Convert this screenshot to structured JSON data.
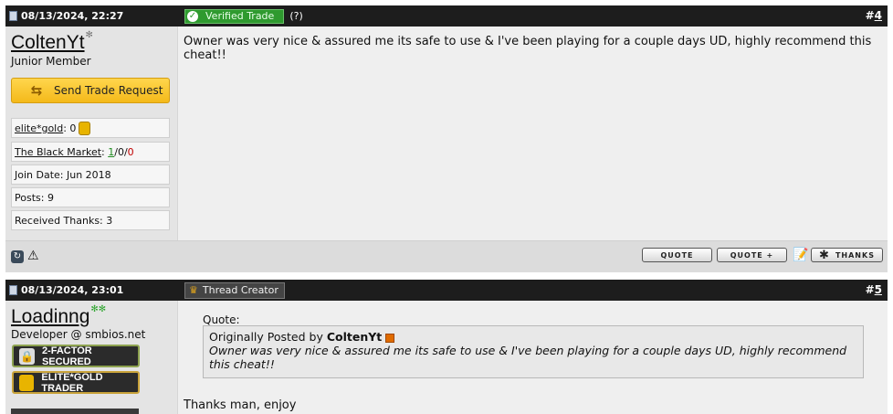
{
  "posts": [
    {
      "date": "08/13/2024, 22:27",
      "badge": "Verified Trade",
      "help": "(?)",
      "number_prefix": "#",
      "number": "4",
      "username": "ColtenYt",
      "role": "Junior Member",
      "trade_button": "Send Trade Request",
      "stats": {
        "elite_gold_label": "elite*gold",
        "elite_gold_value": ": 0",
        "black_market_label": "The Black Market",
        "bm_sep1": ": ",
        "bm_pos": "1",
        "bm_sep2": "/0/",
        "bm_neg": "0",
        "join_date": "Join Date: Jun 2018",
        "posts": "Posts: 9",
        "thanks": "Received Thanks: 3"
      },
      "message": "Owner was very nice & assured me its safe to use & I've been playing for a couple days UD, highly recommend this cheat!!",
      "footer": {
        "quote": "QUOTE",
        "multiquote": "QUOTE +",
        "thanks": "THANKS"
      }
    },
    {
      "date": "08/13/2024, 23:01",
      "badge": "Thread Creator",
      "number_prefix": "#",
      "number": "5",
      "username": "Loadinng",
      "role": "Developer @ smbios.net",
      "badges": [
        "2-FACTOR SECURED",
        "ELITE*GOLD TRADER"
      ],
      "quote_label": "Quote:",
      "quote_prefix": "Originally Posted by",
      "quote_author": "ColtenYt",
      "quote_text": "Owner was very nice & assured me its safe to use & I've been playing for a couple days UD, highly recommend this cheat!!",
      "message": "Thanks man, enjoy"
    }
  ],
  "colors": {
    "header": "#1d1d1d",
    "verified": "#2f9a2f",
    "gold": "#f4b91a"
  }
}
